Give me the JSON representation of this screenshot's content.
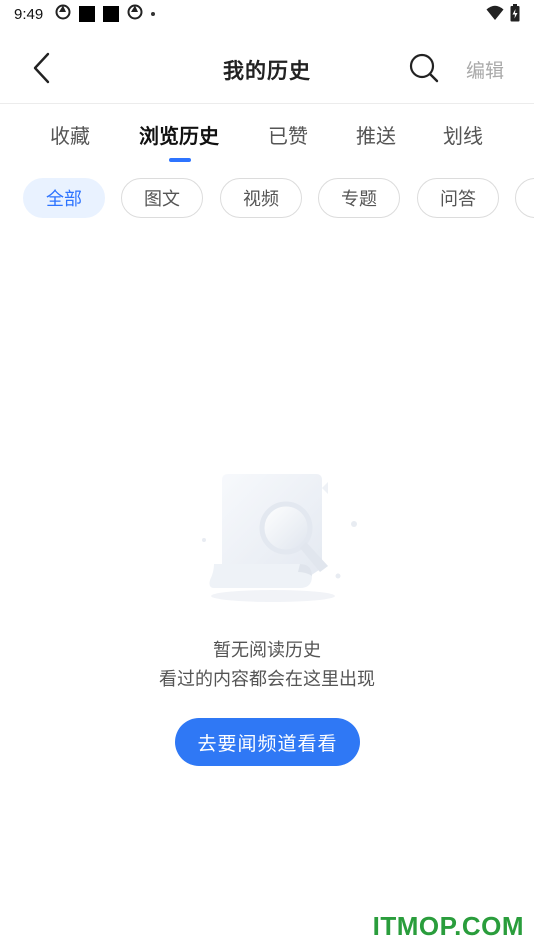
{
  "status_bar": {
    "time": "9:49",
    "icons": [
      "aperture-icon",
      "square-icon",
      "square-icon",
      "aperture-icon",
      "dot-icon"
    ],
    "right_icons": [
      "wifi-icon",
      "battery-charging-icon"
    ]
  },
  "header": {
    "title": "我的历史",
    "edit_label": "编辑",
    "back_icon": "chevron-left-icon",
    "search_icon": "search-icon"
  },
  "tabs": [
    {
      "label": "收藏",
      "active": false
    },
    {
      "label": "浏览历史",
      "active": true
    },
    {
      "label": "已赞",
      "active": false
    },
    {
      "label": "推送",
      "active": false
    },
    {
      "label": "划线",
      "active": false
    }
  ],
  "chips": [
    {
      "label": "全部",
      "active": true
    },
    {
      "label": "图文",
      "active": false
    },
    {
      "label": "视频",
      "active": false
    },
    {
      "label": "专题",
      "active": false
    },
    {
      "label": "问答",
      "active": false
    },
    {
      "label": "",
      "active": false
    }
  ],
  "empty_state": {
    "title": "暂无阅读历史",
    "subtitle": "看过的内容都会在这里出现",
    "cta_label": "去要闻频道看看",
    "illustration_icon": "document-search-icon"
  },
  "watermark": "ITMOP.COM",
  "colors": {
    "accent": "#2e74ff",
    "chip_active_bg": "#e9f2ff",
    "cta_bg": "#2f78f5",
    "watermark": "#2a9d3c"
  }
}
